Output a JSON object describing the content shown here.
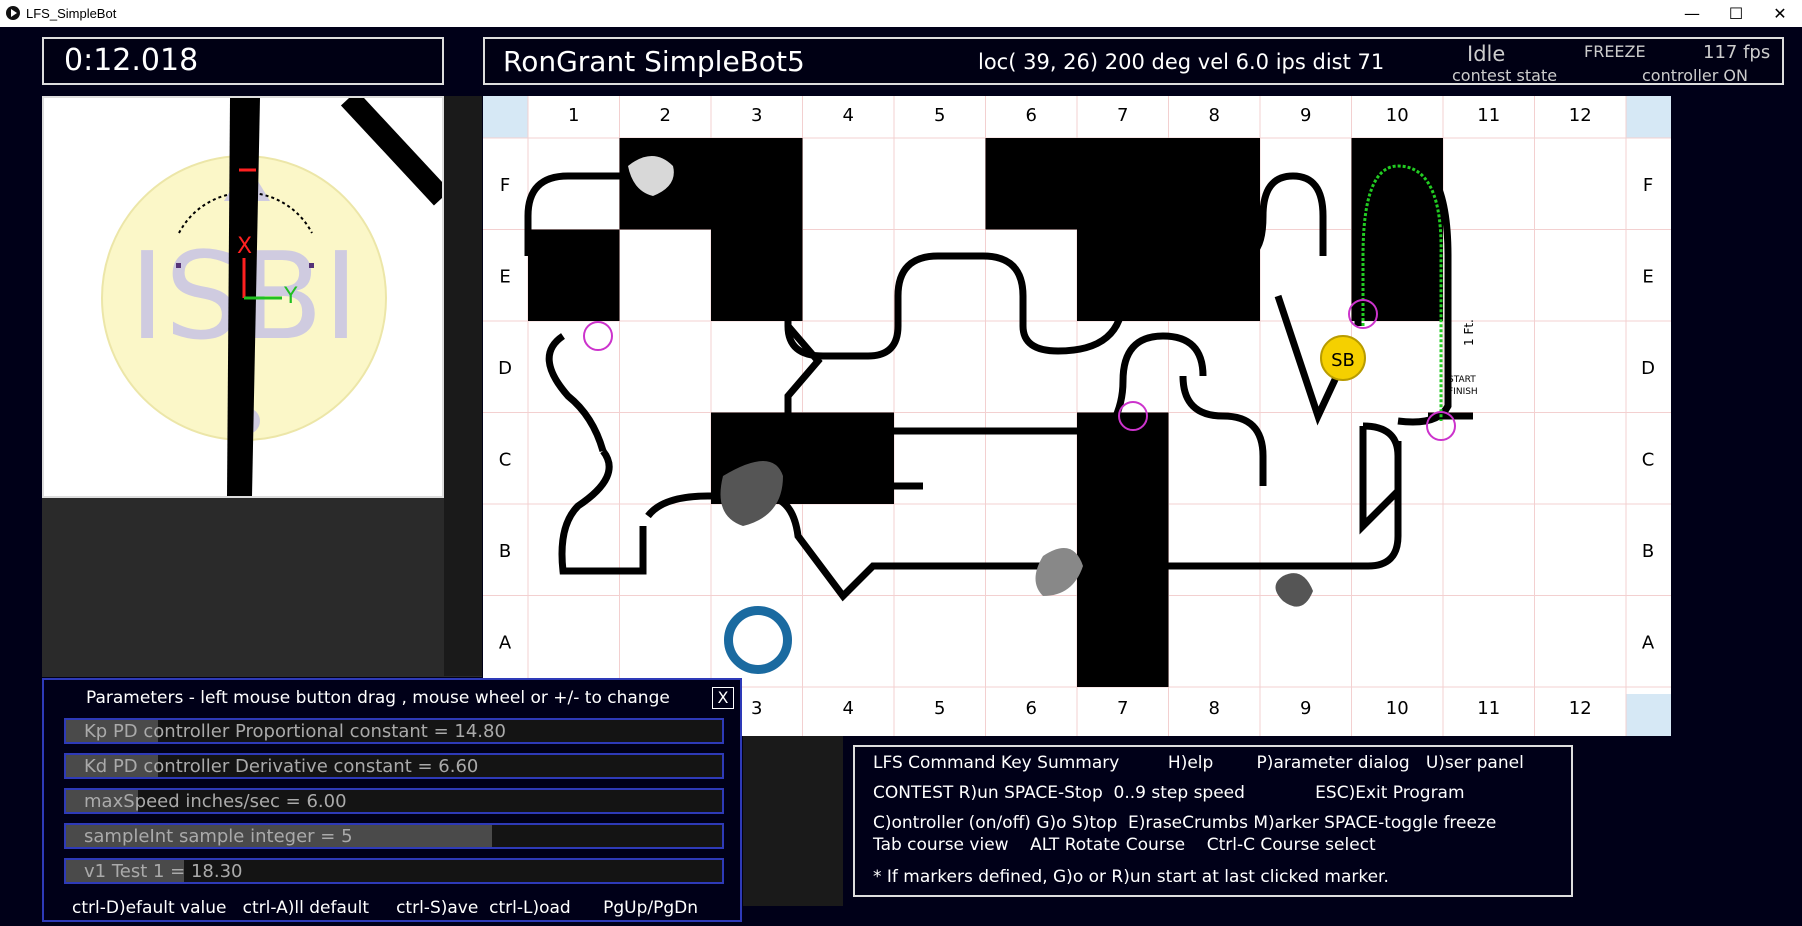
{
  "window": {
    "title": "LFS_SimpleBot",
    "minimize": "—",
    "maximize": "☐",
    "close": "✕"
  },
  "timer": "0:12.018",
  "header": {
    "name": "RonGrant  SimpleBot5",
    "loc": "loc( 39, 26) 200 deg  vel 6.0 ips dist 71",
    "state": "Idle",
    "state_label": "contest state",
    "freeze": "FREEZE",
    "fps": "117 fps",
    "controller": "controller ON"
  },
  "sensor": {
    "logo_text": "ISBI",
    "x_label": "X",
    "y_label": "Y"
  },
  "course": {
    "columns": [
      "1",
      "2",
      "3",
      "4",
      "5",
      "6",
      "7",
      "8",
      "9",
      "10",
      "11",
      "12"
    ],
    "rows": [
      "F",
      "E",
      "D",
      "C",
      "B",
      "A"
    ],
    "labels": {
      "start": "START",
      "finish": "FINISH",
      "one_ft": "1 Ft."
    }
  },
  "params": {
    "title": "Parameters - left mouse button drag , mouse wheel or +/- to change",
    "close": "X",
    "sliders": [
      {
        "label": "Kp  PD controller Proportional constant  = 14.80",
        "fraction": 0.14
      },
      {
        "label": "Kd  PD controller Derivative constant  = 6.60",
        "fraction": 0.14
      },
      {
        "label": "maxSpeed  inches/sec   = 6.00",
        "fraction": 0.11
      },
      {
        "label": "sampleInt  sample integer  = 5",
        "fraction": 0.65
      },
      {
        "label": "v1  Test 1  = 18.30",
        "fraction": 0.18
      }
    ],
    "footer": "ctrl-D)efault value   ctrl-A)ll default     ctrl-S)ave  ctrl-L)oad      PgUp/PgDn"
  },
  "commands": {
    "line1": "LFS Command Key Summary         H)elp        P)arameter dialog   U)ser panel",
    "line2": "CONTEST R)un SPACE-Stop  0..9 step speed             ESC)Exit Program",
    "line3": "C)ontroller (on/off) G)o S)top  E)raseCrumbs M)arker SPACE-toggle freeze",
    "line4": "Tab course view    ALT Rotate Course    Ctrl-C Course select",
    "line5": "* If markers defined, G)o or R)un start at last clicked marker."
  },
  "colors": {
    "panel_border": "#dddddd",
    "param_border": "#2e3ab8",
    "bot": "#f5d000",
    "marker": "#cc33cc",
    "path": "#22cc22"
  }
}
